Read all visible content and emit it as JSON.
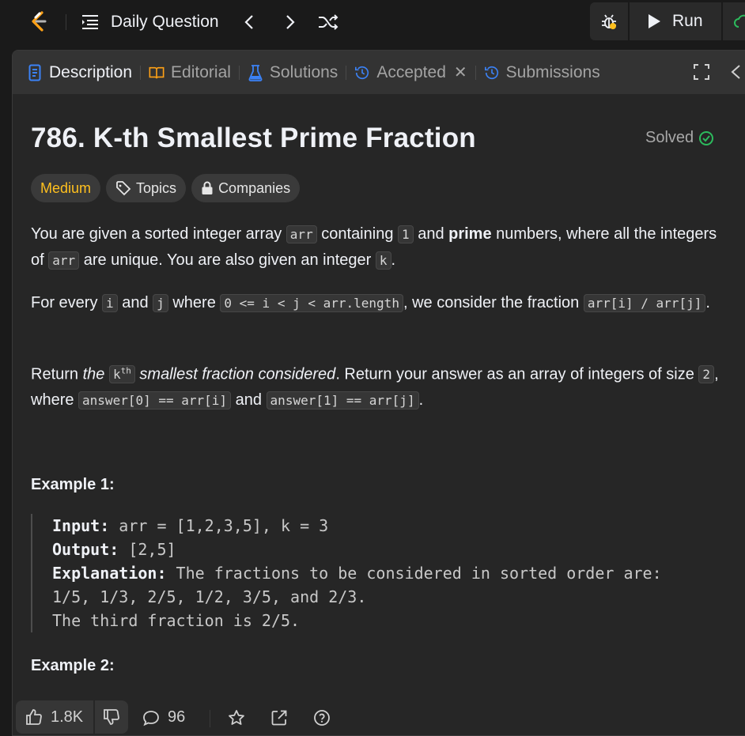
{
  "nav": {
    "title": "Daily Question",
    "run_label": "Run"
  },
  "tabs": [
    {
      "label": "Description",
      "active": true
    },
    {
      "label": "Editorial"
    },
    {
      "label": "Solutions"
    },
    {
      "label": "Accepted",
      "closable": true
    },
    {
      "label": "Submissions"
    }
  ],
  "problem": {
    "title": "786. K-th Smallest Prime Fraction",
    "status": "Solved",
    "difficulty": "Medium",
    "topics_label": "Topics",
    "companies_label": "Companies"
  },
  "description": {
    "p1": {
      "t1": "You are given a sorted integer array ",
      "c1": "arr",
      "t2": " containing ",
      "c2": "1",
      "t3": " and ",
      "b1": "prime",
      "t4": " numbers, where all the integers of ",
      "c3": "arr",
      "t5": " are unique. You are also given an integer ",
      "c4": "k",
      "t6": "."
    },
    "p2": {
      "t1": "For every ",
      "c1": "i",
      "t2": " and ",
      "c2": "j",
      "t3": " where ",
      "c3": "0 <= i < j < arr.length",
      "t4": ", we consider the fraction ",
      "c4": "arr[i] / arr[j]",
      "t5": "."
    },
    "p3": {
      "t1": "Return ",
      "i1": "the",
      "c1": "k",
      "c1_sup": "th",
      "i2": " smallest fraction considered",
      "t2": ". Return your answer as an array of integers of size ",
      "c2": "2",
      "t3": ", where ",
      "c3": "answer[0] == arr[i]",
      "t4": " and ",
      "c4": "answer[1] == arr[j]",
      "t5": "."
    }
  },
  "example1": {
    "title": "Example 1:",
    "input_label": "Input:",
    "input": "arr = [1,2,3,5], k = 3",
    "output_label": "Output:",
    "output": "[2,5]",
    "explanation_label": "Explanation:",
    "explanation_1": "The fractions to be considered in sorted order are:",
    "explanation_2": "1/5, 1/3, 2/5, 1/2, 3/5, and 2/3.",
    "explanation_3": "The third fraction is 2/5."
  },
  "example2": {
    "title": "Example 2:"
  },
  "footer": {
    "likes": "1.8K",
    "comments": "96"
  },
  "colors": {
    "medium": "#ffc01e",
    "solved_check": "#2cbb5d",
    "accent_blue": "#3b82f6",
    "submit_green": "#2cbb5d"
  }
}
